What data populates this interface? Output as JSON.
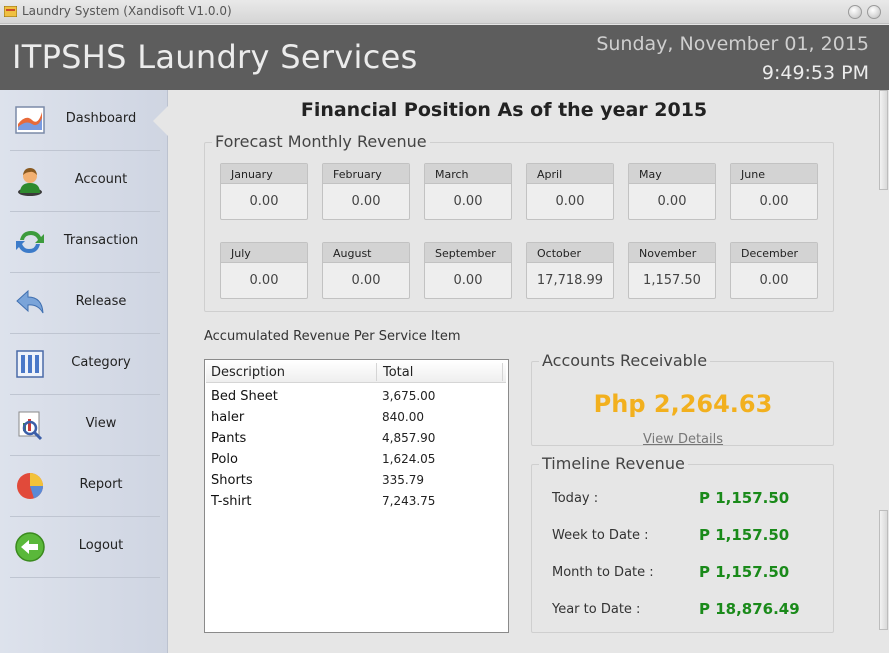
{
  "window": {
    "title": "Laundry System (Xandisoft V1.0.0)"
  },
  "header": {
    "brand": "ITPSHS Laundry Services",
    "date": "Sunday, November 01, 2015",
    "time": "9:49:53 PM"
  },
  "sidebar": {
    "items": [
      {
        "label": "Dashboard",
        "icon": "chart-icon"
      },
      {
        "label": "Account",
        "icon": "user-icon"
      },
      {
        "label": "Transaction",
        "icon": "refresh-icon"
      },
      {
        "label": "Release",
        "icon": "reply-icon"
      },
      {
        "label": "Category",
        "icon": "columns-icon"
      },
      {
        "label": "View",
        "icon": "magnifier-chart-icon"
      },
      {
        "label": "Report",
        "icon": "pie-chart-icon"
      },
      {
        "label": "Logout",
        "icon": "back-arrow-icon"
      }
    ]
  },
  "main": {
    "title": "Financial Position As of the year 2015",
    "forecast": {
      "title": "Forecast Monthly Revenue",
      "months": [
        {
          "name": "January",
          "value": "0.00"
        },
        {
          "name": "February",
          "value": "0.00"
        },
        {
          "name": "March",
          "value": "0.00"
        },
        {
          "name": "April",
          "value": "0.00"
        },
        {
          "name": "May",
          "value": "0.00"
        },
        {
          "name": "June",
          "value": "0.00"
        },
        {
          "name": "July",
          "value": "0.00"
        },
        {
          "name": "August",
          "value": "0.00"
        },
        {
          "name": "September",
          "value": "0.00"
        },
        {
          "name": "October",
          "value": "17,718.99"
        },
        {
          "name": "November",
          "value": "1,157.50"
        },
        {
          "name": "December",
          "value": "0.00"
        }
      ]
    },
    "accumulated": {
      "title": "Accumulated Revenue Per Service Item",
      "columns": {
        "description": "Description",
        "total": "Total"
      },
      "rows": [
        {
          "description": "Bed Sheet",
          "total": "3,675.00"
        },
        {
          "description": "haler",
          "total": "840.00"
        },
        {
          "description": "Pants",
          "total": "4,857.90"
        },
        {
          "description": "Polo",
          "total": "1,624.05"
        },
        {
          "description": "Shorts",
          "total": "335.79"
        },
        {
          "description": "T-shirt",
          "total": "7,243.75"
        }
      ]
    },
    "receivable": {
      "title": "Accounts Receivable",
      "amount": "Php 2,264.63",
      "link": "View Details"
    },
    "timeline": {
      "title": "Timeline Revenue",
      "rows": [
        {
          "label": "Today :",
          "value": "P 1,157.50"
        },
        {
          "label": "Week to Date :",
          "value": "P 1,157.50"
        },
        {
          "label": "Month to Date :",
          "value": "P 1,157.50"
        },
        {
          "label": "Year to Date :",
          "value": "P 18,876.49"
        }
      ]
    }
  },
  "colors": {
    "header_bg": "#5d5d5d",
    "receivable_amount": "#f2b01e",
    "timeline_value": "#1a8a1a"
  }
}
